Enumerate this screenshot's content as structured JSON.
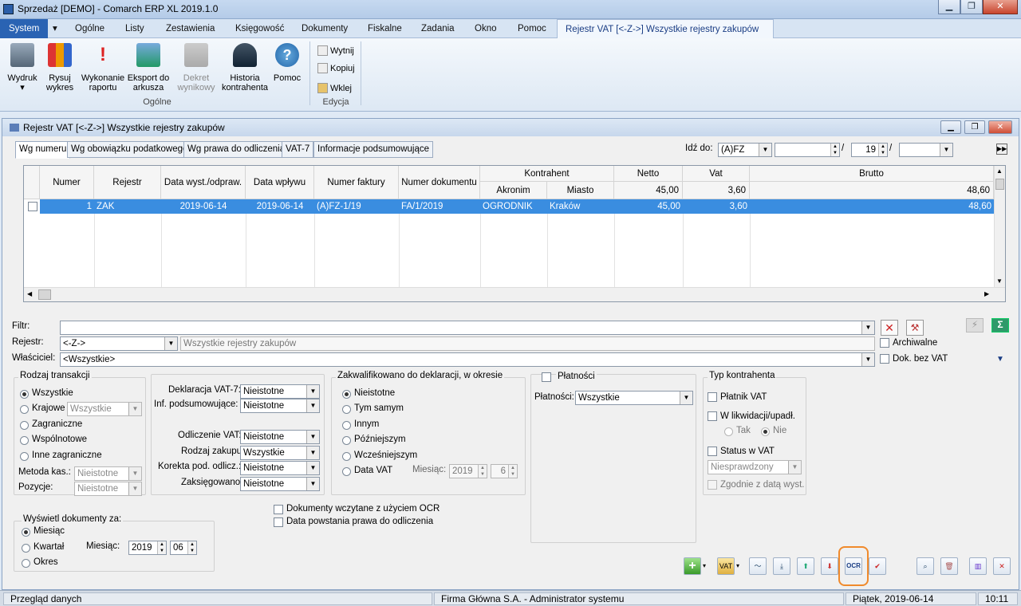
{
  "window_title": "Sprzedaż [DEMO] - Comarch ERP XL 2019.1.0",
  "ribbon_tabs": [
    "System",
    "Ogólne",
    "Listy",
    "Zestawienia",
    "Księgowość",
    "Dokumenty",
    "Fiskalne",
    "Zadania",
    "Okno",
    "Pomoc"
  ],
  "context_tab": "Rejestr VAT   [<-Z->]   Wszystkie rejestry zakupów",
  "ribbon": {
    "print": "Wydruk",
    "chart": "Rysuj wykres",
    "run_report": "Wykonanie raportu",
    "export": "Eksport do arkusza",
    "decree": "Dekret wynikowy",
    "history": "Historia kontrahenta",
    "help": "Pomoc",
    "group_general": "Ogólne",
    "cut": "Wytnij",
    "copy": "Kopiuj",
    "paste": "Wklej",
    "group_edit": "Edycja"
  },
  "mdi_title": "Rejestr VAT   [<-Z->]   Wszystkie rejestry zakupów",
  "inner_tabs": [
    "Wg numeru",
    "Wg obowiązku podatkowego",
    "Wg prawa do odliczenia",
    "VAT-7",
    "Informacje podsumowujące"
  ],
  "goto": {
    "label": "Idź do:",
    "value": "(A)FZ",
    "num": "19",
    "slash": "/"
  },
  "grid": {
    "headers": {
      "numer": "Numer",
      "rejestr": "Rejestr",
      "data_wyst": "Data wyst./odpraw.",
      "data_wplywu": "Data wpływu",
      "numer_faktury": "Numer faktury",
      "numer_dokumentu": "Numer dokumentu",
      "kontrahent": "Kontrahent",
      "akronim": "Akronim",
      "miasto": "Miasto",
      "netto": "Netto",
      "vat": "Vat",
      "brutto": "Brutto"
    },
    "totals": {
      "netto": "45,00",
      "vat": "3,60",
      "brutto": "48,60"
    },
    "row": {
      "numer": "1",
      "rejestr": "ZAK",
      "data_wyst": "2019-06-14",
      "data_wplywu": "2019-06-14",
      "numer_faktury": "(A)FZ-1/19",
      "numer_dokumentu": "FA/1/2019",
      "akronim": "OGRODNIK",
      "miasto": "Kraków",
      "netto": "45,00",
      "vat": "3,60",
      "brutto": "48,60"
    }
  },
  "filters": {
    "filtr_label": "Filtr:",
    "rejestr_label": "Rejestr:",
    "rejestr_value": "<-Z->",
    "rejestr_desc": "Wszystkie rejestry zakupów",
    "wlasciciel_label": "Właściciel:",
    "wlasciciel_value": "<Wszystkie>",
    "archiwalne": "Archiwalne",
    "dok_bez_vat": "Dok. bez VAT"
  },
  "rodzaj": {
    "title": "Rodzaj transakcji",
    "opts": [
      "Wszystkie",
      "Krajowe",
      "Zagraniczne",
      "Wspólnotowe",
      "Inne zagraniczne"
    ],
    "krajowe_value": "Wszystkie",
    "metoda_label": "Metoda kas.:",
    "metoda_value": "Nieistotne",
    "pozycje_label": "Pozycje:",
    "pozycje_value": "Nieistotne"
  },
  "deklaracje": {
    "vat7_label": "Deklaracja VAT-7:",
    "vat7": "Nieistotne",
    "inf_label": "Inf. podsumowujące:",
    "inf": "Nieistotne",
    "odl_label": "Odliczenie VAT:",
    "odl": "Nieistotne",
    "rodz_label": "Rodzaj zakupu:",
    "rodz": "Wszystkie",
    "kor_label": "Korekta pod. odlicz.:",
    "kor": "Nieistotne",
    "zaks_label": "Zaksięgowano:",
    "zaks": "Nieistotne"
  },
  "zakw": {
    "title": "Zakwalifikowano do deklaracji, w okresie",
    "opts": [
      "Nieistotne",
      "Tym samym",
      "Innym",
      "Późniejszym",
      "Wcześniejszym",
      "Data VAT"
    ],
    "miesiac_label": "Miesiąc:",
    "rok": "2019",
    "mies": "6"
  },
  "platnosci": {
    "title": "Płatności",
    "label": "Płatności:",
    "value": "Wszystkie"
  },
  "typ": {
    "title": "Typ kontrahenta",
    "platnik": "Płatnik VAT",
    "likw": "W likwidacji/upadł.",
    "tak": "Tak",
    "nie": "Nie",
    "status": "Status w VAT",
    "status_value": "Niesprawdzony",
    "zgodnie": "Zgodnie z datą wyst."
  },
  "ocr": {
    "ocr_docs": "Dokumenty wczytane z użyciem OCR",
    "data_prawa": "Data powstania prawa do odliczenia"
  },
  "wyswietl": {
    "title": "Wyświetl dokumenty za:",
    "opts": [
      "Miesiąc",
      "Kwartał",
      "Okres"
    ],
    "miesiac_label": "Miesiąc:",
    "rok": "2019",
    "mies": "06"
  },
  "ocr_button": "OCR",
  "status": {
    "left": "Przegląd danych",
    "mid": "Firma Główna S.A. - Administrator systemu",
    "date": "Piątek, 2019-06-14",
    "time": "10:11"
  }
}
